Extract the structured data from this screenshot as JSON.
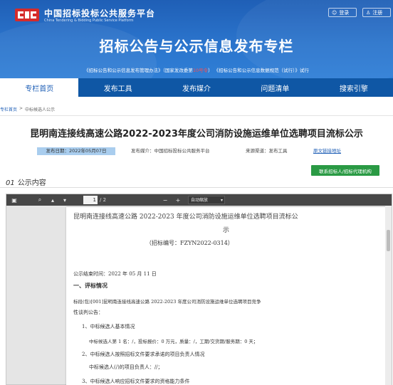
{
  "header": {
    "logo_title": "中国招标投标公共服务平台",
    "logo_subtitle": "China Tendering & Bidding Public Service Platform",
    "login_label": "登录",
    "register_label": "注册",
    "main_title": "招标公告与公示信息发布专栏",
    "notice_part1": "《招标公告和公示信息发布管理办法》（国家发改委第",
    "notice_red": "10号令",
    "notice_part2": "）     《招标公告和公示信息数据规范（试行）》试行"
  },
  "nav": {
    "items": [
      "专栏首页",
      "发布工具",
      "发布媒介",
      "问题清单",
      "搜索引擎"
    ]
  },
  "breadcrumb": {
    "home": "专栏首页",
    "sep": ">",
    "current": "中标候选人公示"
  },
  "article": {
    "title": "昆明南连接线高速公路2022-2023年度公司消防设施运维单位选聘项目流标公示",
    "date": "发布日期：2022年05月07日",
    "media": "发布媒介：中国招标投标公共服务平台",
    "channel": "来源渠道：发布工具",
    "original_link": "原文链接地址",
    "contact_button": "联系招标人/招标代理机构"
  },
  "section": {
    "num": "01",
    "label": "公示内容"
  },
  "pdf_toolbar": {
    "page_current": "1",
    "page_total": "/ 2",
    "zoom": "自动缩放",
    "minus": "−",
    "plus": "+"
  },
  "pdf_content": {
    "title_line1": "昆明南连接线高速公路 2022-2023 年度公司消防设施运维单位选聘项目流标公",
    "title_line2": "示",
    "bid_no": "（招标编号：FZYN2022-0314）",
    "end_time": "公示结束时间：2022 年 05 月 11 日",
    "section1": "一、评标情况",
    "para1": "标段(包)[001]昆明南连接线高速公路 2022-2023 年度公司消防设施运维单位选聘项目竞争",
    "para1b": "性谈判公告：",
    "item1": "1、中标候选人基本情况",
    "item1a": "中标候选人第 1 名：/，投标报价：0 万元，质量：/，工期/交货期/服务期：0 天；",
    "item2": "2、中标候选人按照招标文件要求承诺的项目负责人情况",
    "item2a": "中标候选人(/)的项目负责人：//；",
    "item3": "3、中标候选人响应招标文件要求的资格能力条件"
  },
  "colors": {
    "banner": "#2b74cc",
    "nav": "#0f57a5",
    "green_button": "#2a9a44",
    "date_highlight": "#a9cdee"
  }
}
